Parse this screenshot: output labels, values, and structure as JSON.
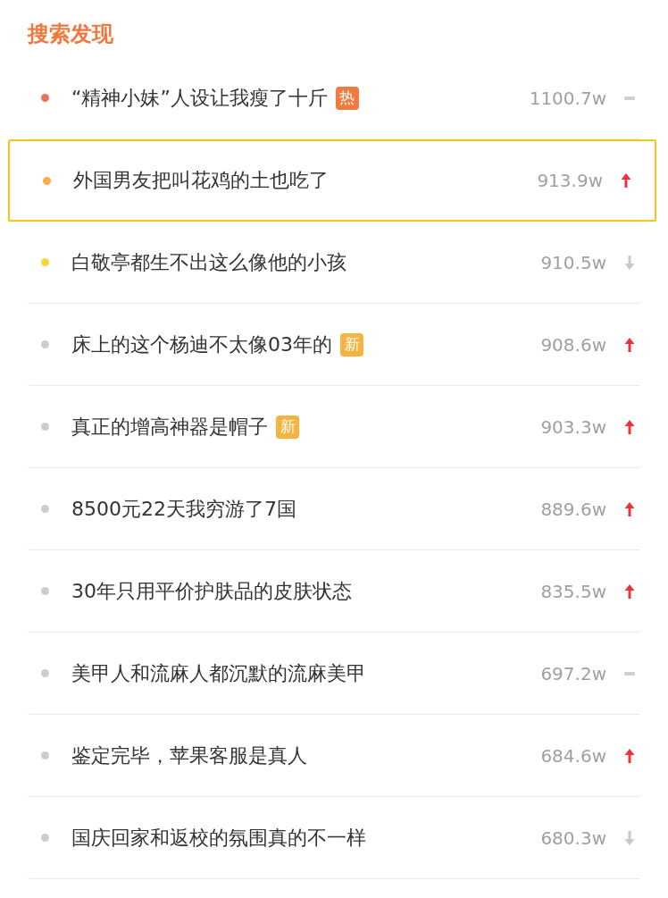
{
  "section_title": "搜索发现",
  "items": [
    {
      "text": "“精神小妹”人设让我瘦了十斤",
      "badge": {
        "text": "热",
        "color": "#f07b3f"
      },
      "count": "1100.7w",
      "kind": "flat",
      "color": "#f0715a",
      "selected": false
    },
    {
      "text": "外国男友把叫花鸡的土也吃了",
      "count": "913.9w",
      "kind": "up",
      "color": "#f5ad4e",
      "selected": true
    },
    {
      "text": "白敬亭都生不出这么像他的小孩",
      "count": "910.5w",
      "kind": "down",
      "color": "#f8d53c",
      "selected": false
    },
    {
      "text": "床上的这个杨迪不太像03年的",
      "badge": {
        "text": "新",
        "color": "#f4b43f"
      },
      "count": "908.6w",
      "kind": "up",
      "color": "#cccccc",
      "selected": false
    },
    {
      "text": "真正的增高神器是帽子",
      "badge": {
        "text": "新",
        "color": "#f4b43f"
      },
      "count": "903.3w",
      "kind": "up",
      "color": "#cccccc",
      "selected": false
    },
    {
      "text": "8500元22天我穷游了7国",
      "count": "889.6w",
      "kind": "up",
      "color": "#cccccc",
      "selected": false
    },
    {
      "text": "30年只用平价护肤品的皮肤状态",
      "count": "835.5w",
      "kind": "up",
      "color": "#cccccc",
      "selected": false
    },
    {
      "text": "美甲人和流麻人都沉默的流麻美甲",
      "count": "697.2w",
      "kind": "flat",
      "color": "#cccccc",
      "selected": false
    },
    {
      "text": "鉴定完毕，苹果客服是真人",
      "count": "684.6w",
      "kind": "up",
      "color": "#cccccc",
      "selected": false
    },
    {
      "text": "国庆回家和返校的氛围真的不一样",
      "count": "680.3w",
      "kind": "down",
      "color": "#cccccc",
      "selected": false
    }
  ]
}
